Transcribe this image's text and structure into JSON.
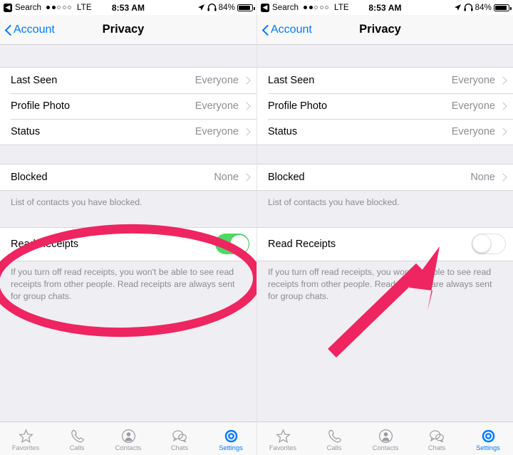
{
  "statusbar": {
    "back_label": "Search",
    "back_icon": "back-arrow-icon",
    "signal_dots_filled": 2,
    "signal_dots_total": 5,
    "carrier_tech": "LTE",
    "time": "8:53 AM",
    "location_icon": "location-arrow-icon",
    "headphones_icon": "headphones-icon",
    "battery_percent": "84%",
    "battery_icon": "battery-icon"
  },
  "navbar": {
    "back_label": "Account",
    "back_icon": "chevron-left-icon",
    "title": "Privacy"
  },
  "privacy_group": {
    "rows": [
      {
        "label": "Last Seen",
        "value": "Everyone",
        "chevron": "chevron-right-icon"
      },
      {
        "label": "Profile Photo",
        "value": "Everyone",
        "chevron": "chevron-right-icon"
      },
      {
        "label": "Status",
        "value": "Everyone",
        "chevron": "chevron-right-icon"
      }
    ]
  },
  "blocked_group": {
    "label": "Blocked",
    "value": "None",
    "chevron": "chevron-right-icon",
    "footer": "List of contacts you have blocked."
  },
  "read_receipts_group": {
    "label": "Read Receipts",
    "footer": "If you turn off read receipts, you won't be able to see read receipts from other people. Read receipts are always sent for group chats.",
    "left_state": "on",
    "right_state": "off"
  },
  "tabbar": {
    "tabs": [
      {
        "label": "Favorites",
        "icon": "star-icon",
        "active": false
      },
      {
        "label": "Calls",
        "icon": "phone-icon",
        "active": false
      },
      {
        "label": "Contacts",
        "icon": "person-icon",
        "active": false
      },
      {
        "label": "Chats",
        "icon": "chat-bubbles-icon",
        "active": false
      },
      {
        "label": "Settings",
        "icon": "gear-icon",
        "active": true
      }
    ]
  },
  "annotations": {
    "color": "#EE2560",
    "ellipse_target": "read-receipts-row-left",
    "arrow_target": "read-receipts-toggle-right"
  },
  "theme": {
    "accent_blue": "#007AFF",
    "toggle_on_green": "#4CD964",
    "background": "#EFEEF3",
    "secondary_text": "#8E8E93"
  }
}
